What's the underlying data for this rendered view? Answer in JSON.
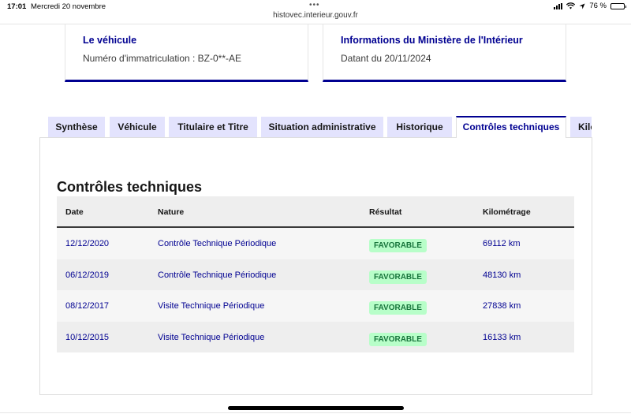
{
  "status_bar": {
    "time": "17:01",
    "date": "Mercredi 20 novembre",
    "dots": "•••",
    "battery": "76 %",
    "battery_level": 0.76
  },
  "browser": {
    "url": "histovec.interieur.gouv.fr"
  },
  "cards": {
    "vehicle": {
      "title": "Le véhicule",
      "text": "Numéro d'immatriculation : BZ-0**-AE"
    },
    "ministry": {
      "title": "Informations du Ministère de l'Intérieur",
      "text": "Datant du 20/11/2024"
    }
  },
  "tabs": [
    {
      "label": "Synthèse"
    },
    {
      "label": "Véhicule"
    },
    {
      "label": "Titulaire et Titre"
    },
    {
      "label": "Situation administrative"
    },
    {
      "label": "Historique"
    },
    {
      "label": "Contrôles techniques",
      "active": true
    },
    {
      "label": "Kilométrage"
    }
  ],
  "section": {
    "title": "Contrôles techniques",
    "columns": {
      "date": "Date",
      "nature": "Nature",
      "result": "Résultat",
      "km": "Kilométrage"
    },
    "rows": [
      {
        "date": "12/12/2020",
        "nature": "Contrôle Technique Périodique",
        "result": "FAVORABLE",
        "km": "69112 km"
      },
      {
        "date": "06/12/2019",
        "nature": "Contrôle Technique Périodique",
        "result": "FAVORABLE",
        "km": "48130 km"
      },
      {
        "date": "08/12/2017",
        "nature": "Visite Technique Périodique",
        "result": "FAVORABLE",
        "km": "27838 km"
      },
      {
        "date": "10/12/2015",
        "nature": "Visite Technique Périodique",
        "result": "FAVORABLE",
        "km": "16133 km"
      }
    ]
  },
  "colors": {
    "primary": "#000091",
    "tab_bg": "#e3e3fd",
    "success_bg": "#b8fec9",
    "success_text": "#18753c"
  }
}
